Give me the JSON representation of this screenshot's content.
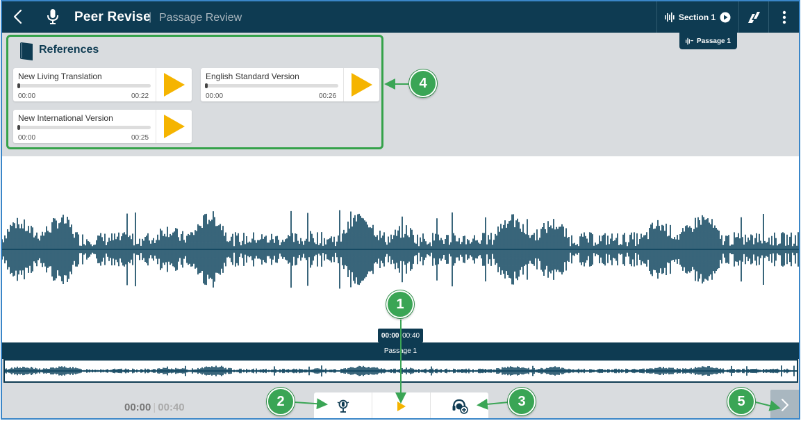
{
  "header": {
    "app_title": "Peer Revise",
    "separator": "|",
    "subtitle": "Passage Review",
    "section_label": "Section 1",
    "passage_tooltip": "Passage 1",
    "icons": [
      "chevron-left-icon",
      "microphone-icon",
      "waveform-icon",
      "play-circle-icon",
      "app-logo-icon",
      "more-vertical-icon"
    ]
  },
  "references": {
    "title": "References",
    "items": [
      {
        "name": "New Living Translation",
        "start": "00:00",
        "end": "00:22",
        "progress": 0
      },
      {
        "name": "English Standard Version",
        "start": "00:00",
        "end": "00:26",
        "progress": 0
      },
      {
        "name": "New International Version",
        "start": "00:00",
        "end": "00:25",
        "progress": 0
      }
    ]
  },
  "player": {
    "tooltip_current": "00:00",
    "tooltip_separator": "|",
    "tooltip_total": "00:40",
    "passage_label": "Passage 1",
    "current_time": "00:00",
    "time_separator": "|",
    "total_time": "00:40",
    "progress": 0
  },
  "controls": {
    "icons": [
      "mic-record-icon",
      "play-icon",
      "headset-add-icon",
      "chevron-right-icon"
    ]
  },
  "callouts": [
    "1",
    "2",
    "3",
    "4",
    "5"
  ],
  "colors": {
    "header_bg": "#0e3b52",
    "accent_play": "#f5b400",
    "callout_green": "#3aa555",
    "frame_border": "#3a86c8",
    "panel_bg": "#d9dcdf"
  }
}
